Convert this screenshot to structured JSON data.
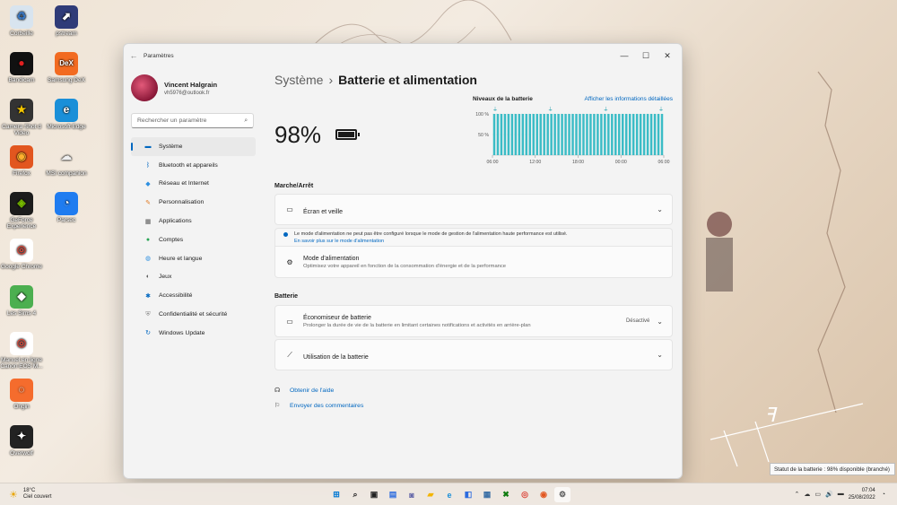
{
  "desktop": {
    "icons": [
      {
        "label": "Corbeille",
        "glyph": "♻",
        "bg": "#d8e4ef",
        "color": "#3a78c2"
      },
      {
        "label": "pstream",
        "glyph": "⬈",
        "bg": "#2f3b78",
        "color": "#fff"
      },
      {
        "label": "Bandicam",
        "glyph": "●",
        "bg": "#111",
        "color": "#e02020"
      },
      {
        "label": "Samsung DeX",
        "glyph": "DeX",
        "bg": "#f26b21",
        "color": "#fff"
      },
      {
        "label": "Camera Shot d Video",
        "glyph": "★",
        "bg": "#333",
        "color": "#f3c500"
      },
      {
        "label": "Microsoft Edge",
        "glyph": "e",
        "bg": "#1a8fd8",
        "color": "#fff"
      },
      {
        "label": "Firefox",
        "glyph": "◉",
        "bg": "#e2561f",
        "color": "#ffb02e"
      },
      {
        "label": "MSI companion",
        "glyph": "☁",
        "bg": "transparent",
        "color": "#eee"
      },
      {
        "label": "GeForce Experience",
        "glyph": "◈",
        "bg": "#1c1c1c",
        "color": "#76b900"
      },
      {
        "label": "Parsec",
        "glyph": "◔",
        "bg": "#1f7cf0",
        "color": "#fff"
      },
      {
        "label": "Google Chrome",
        "glyph": "◎",
        "bg": "#fff",
        "color": "#db4437"
      },
      {
        "label": "Les Sims 4",
        "glyph": "◆",
        "bg": "#4caf50",
        "color": "#fff"
      },
      {
        "label": "Manuel en ligne Canon EOS M...",
        "glyph": "◎",
        "bg": "#fff",
        "color": "#db4437"
      },
      {
        "label": "Origin",
        "glyph": "◌",
        "bg": "#f56c2d",
        "color": "#fff"
      },
      {
        "label": "Overwolf",
        "glyph": "✦",
        "bg": "#222",
        "color": "#fff"
      }
    ]
  },
  "window": {
    "title": "Paramètres",
    "controls": {
      "minimize": "—",
      "maximize": "☐",
      "close": "✕"
    },
    "back": "←"
  },
  "profile": {
    "name": "Vincent Halgrain",
    "email": "vh5976@outlook.fr"
  },
  "search": {
    "placeholder": "Rechercher un paramètre",
    "icon": "⌕"
  },
  "nav": [
    {
      "label": "Système",
      "icon": "▬",
      "color": "#0067c0"
    },
    {
      "label": "Bluetooth et appareils",
      "icon": "ᛒ",
      "color": "#0067c0"
    },
    {
      "label": "Réseau et Internet",
      "icon": "◆",
      "color": "#2d8fe0"
    },
    {
      "label": "Personnalisation",
      "icon": "✎",
      "color": "#e07a22"
    },
    {
      "label": "Applications",
      "icon": "▦",
      "color": "#555"
    },
    {
      "label": "Comptes",
      "icon": "●",
      "color": "#2aa556"
    },
    {
      "label": "Heure et langue",
      "icon": "◍",
      "color": "#2d8fe0"
    },
    {
      "label": "Jeux",
      "icon": "◐",
      "color": "#555"
    },
    {
      "label": "Accessibilité",
      "icon": "✱",
      "color": "#0067c0"
    },
    {
      "label": "Confidentialité et sécurité",
      "icon": "⛨",
      "color": "#888"
    },
    {
      "label": "Windows Update",
      "icon": "↻",
      "color": "#0067c0"
    }
  ],
  "breadcrumb": {
    "parent": "Système",
    "separator": "›",
    "current": "Batterie et alimentation"
  },
  "battery": {
    "percent": "98%"
  },
  "chart_data": {
    "type": "bar",
    "title": "Niveaux de la batterie",
    "link": "Afficher les informations détaillées",
    "y_ticks": [
      "100 %",
      "50 %"
    ],
    "x_ticks": [
      "06:00",
      "12:00",
      "18:00",
      "00:00",
      "06:00"
    ],
    "ylim": [
      0,
      100
    ],
    "values": [
      100,
      100,
      100,
      100,
      100,
      100,
      100,
      100,
      100,
      100,
      100,
      100,
      100,
      100,
      100,
      100,
      100,
      100,
      100,
      100,
      100,
      100,
      100,
      100,
      100,
      100,
      100,
      100,
      100,
      100,
      100,
      100,
      100,
      100,
      100,
      100,
      100,
      100,
      100,
      100,
      100,
      100,
      100,
      100,
      100,
      100,
      100,
      100
    ],
    "color": "#3bbcc6",
    "plug_markers": 4
  },
  "power_section": {
    "heading": "Marche/Arrêt",
    "screen": {
      "icon": "▭",
      "label": "Écran et veille",
      "chevron": "⌄"
    },
    "notice": {
      "text": "Le mode d'alimentation ne peut pas être configuré lorsque le mode de gestion de l'alimentation haute performance est utilisé.",
      "link": "En savoir plus sur le mode d'alimentation"
    },
    "mode": {
      "icon": "⚙",
      "label": "Mode d'alimentation",
      "desc": "Optimisez votre appareil en fonction de la consommation d'énergie et de la performance"
    }
  },
  "battery_section": {
    "heading": "Batterie",
    "saver": {
      "icon": "▭",
      "label": "Économiseur de batterie",
      "desc": "Prolonger la durée de vie de la batterie en limitant certaines notifications et activités en arrière-plan",
      "value": "Désactivé",
      "chevron": "⌄"
    },
    "usage": {
      "icon": "⟋",
      "label": "Utilisation de la batterie",
      "chevron": "⌄"
    }
  },
  "help": {
    "get_help": {
      "icon": "☊",
      "label": "Obtenir de l'aide"
    },
    "feedback": {
      "icon": "⚐",
      "label": "Envoyer des commentaires"
    }
  },
  "tooltip": "Statut de la batterie : 98% disponible (branché)",
  "taskbar": {
    "weather": {
      "temp": "18°C",
      "desc": "Ciel couvert",
      "icon": "☀"
    },
    "apps": [
      {
        "name": "start",
        "glyph": "⊞",
        "color": "#0078d4"
      },
      {
        "name": "search",
        "glyph": "⌕",
        "color": "#222"
      },
      {
        "name": "task-view",
        "glyph": "▣",
        "color": "#222"
      },
      {
        "name": "widgets",
        "glyph": "▤",
        "color": "#2d6cdf"
      },
      {
        "name": "chat",
        "glyph": "◙",
        "color": "#6264a7"
      },
      {
        "name": "explorer",
        "glyph": "▰",
        "color": "#f4b400"
      },
      {
        "name": "edge",
        "glyph": "e",
        "color": "#1a8fd8"
      },
      {
        "name": "store",
        "glyph": "◧",
        "color": "#2d6cdf"
      },
      {
        "name": "screen",
        "glyph": "▦",
        "color": "#3a6ea5"
      },
      {
        "name": "xbox",
        "glyph": "✖",
        "color": "#107c10"
      },
      {
        "name": "chrome",
        "glyph": "◎",
        "color": "#db4437"
      },
      {
        "name": "firefox",
        "glyph": "◉",
        "color": "#e2561f"
      },
      {
        "name": "settings",
        "glyph": "⚙",
        "color": "#555"
      }
    ],
    "tray": {
      "chevron": "⌃",
      "icons": [
        "☁",
        "▭",
        "🔊",
        "▬"
      ]
    },
    "time": "07:04",
    "date": "25/08/2022",
    "notif": "◔"
  }
}
